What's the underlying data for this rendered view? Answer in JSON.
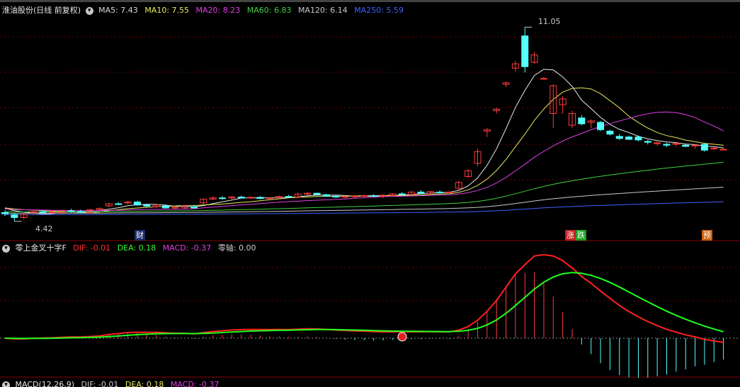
{
  "main_panel": {
    "stock_title": "淮油股份(日线 前复权)",
    "indicators": [
      {
        "text": "MA5: 7.43",
        "color": "#d8d8d8"
      },
      {
        "text": "MA10: 7.55",
        "color": "#e8e860"
      },
      {
        "text": "MA20: 8.23",
        "color": "#e040e0"
      },
      {
        "text": "MA60: 6.83",
        "color": "#40d040"
      },
      {
        "text": "MA120: 6.14",
        "color": "#c8c8c8"
      },
      {
        "text": "MA250: 5.59",
        "color": "#4060ff"
      }
    ],
    "high_label": "11.05",
    "low_label": "4.42",
    "event_badges": [
      {
        "text": "财",
        "bg": "#1a2a6a",
        "color": "#ffffff"
      },
      {
        "text": "涨",
        "bg": "#c02020",
        "color": "#ffffff"
      },
      {
        "text": "跌",
        "bg": "#20a020",
        "color": "#ffffff"
      },
      {
        "text": "预",
        "bg": "#c86010",
        "color": "#ffffff"
      }
    ]
  },
  "sub_panel": {
    "title": "零上金叉十字F",
    "values": [
      {
        "text": "DIF: -0.01",
        "color": "#ff3030"
      },
      {
        "text": "DEA: 0.18",
        "color": "#30ff30"
      },
      {
        "text": "MACD: -0.37",
        "color": "#e040e0"
      },
      {
        "text": "零轴: 0.00",
        "color": "#c8c8c8"
      }
    ]
  },
  "bottom_panel": {
    "title": "MACD(12,26,9)",
    "values": [
      {
        "text": "DIF: -0.01",
        "color": "#c8c8c8"
      },
      {
        "text": "DEA: 0.18",
        "color": "#e8e860"
      },
      {
        "text": "MACD: -0.37",
        "color": "#e040e0"
      }
    ]
  },
  "colors": {
    "up": "#ff3b3b",
    "down": "#54ffff",
    "grid": "#7a0000",
    "background": "#000000"
  },
  "chart_data": {
    "type": "candlestick",
    "candles": [
      {
        "o": 4.72,
        "h": 4.8,
        "l": 4.6,
        "c": 4.68
      },
      {
        "o": 4.65,
        "h": 4.7,
        "l": 4.42,
        "c": 4.55
      },
      {
        "o": 4.55,
        "h": 4.7,
        "l": 4.5,
        "c": 4.65
      },
      {
        "o": 4.72,
        "h": 4.8,
        "l": 4.65,
        "c": 4.75
      },
      {
        "o": 4.75,
        "h": 4.8,
        "l": 4.7,
        "c": 4.72
      },
      {
        "o": 4.72,
        "h": 4.78,
        "l": 4.68,
        "c": 4.74
      },
      {
        "o": 4.72,
        "h": 4.8,
        "l": 4.65,
        "c": 4.78
      },
      {
        "o": 4.78,
        "h": 4.85,
        "l": 4.72,
        "c": 4.76
      },
      {
        "o": 4.76,
        "h": 4.82,
        "l": 4.7,
        "c": 4.73
      },
      {
        "o": 4.72,
        "h": 4.85,
        "l": 4.7,
        "c": 4.82
      },
      {
        "o": 4.82,
        "h": 4.9,
        "l": 4.78,
        "c": 4.86
      },
      {
        "o": 4.95,
        "h": 5.05,
        "l": 4.9,
        "c": 5.02
      },
      {
        "o": 5.02,
        "h": 5.08,
        "l": 4.98,
        "c": 5.0
      },
      {
        "o": 5.05,
        "h": 5.12,
        "l": 5.0,
        "c": 5.08
      },
      {
        "o": 5.08,
        "h": 5.12,
        "l": 4.95,
        "c": 4.98
      },
      {
        "o": 4.98,
        "h": 5.02,
        "l": 4.9,
        "c": 4.94
      },
      {
        "o": 4.92,
        "h": 5.0,
        "l": 4.88,
        "c": 4.98
      },
      {
        "o": 4.95,
        "h": 5.0,
        "l": 4.85,
        "c": 4.88
      },
      {
        "o": 4.88,
        "h": 4.95,
        "l": 4.82,
        "c": 4.9
      },
      {
        "o": 4.88,
        "h": 4.98,
        "l": 4.85,
        "c": 4.95
      },
      {
        "o": 4.92,
        "h": 4.98,
        "l": 4.85,
        "c": 4.88
      },
      {
        "o": 5.05,
        "h": 5.2,
        "l": 5.0,
        "c": 5.18
      },
      {
        "o": 5.18,
        "h": 5.28,
        "l": 5.15,
        "c": 5.22
      },
      {
        "o": 5.22,
        "h": 5.28,
        "l": 5.16,
        "c": 5.2
      },
      {
        "o": 5.22,
        "h": 5.28,
        "l": 5.18,
        "c": 5.25
      },
      {
        "o": 5.25,
        "h": 5.3,
        "l": 5.2,
        "c": 5.22
      },
      {
        "o": 5.22,
        "h": 5.28,
        "l": 5.18,
        "c": 5.24
      },
      {
        "o": 5.24,
        "h": 5.28,
        "l": 5.18,
        "c": 5.2
      },
      {
        "o": 5.2,
        "h": 5.25,
        "l": 5.15,
        "c": 5.22
      },
      {
        "o": 5.22,
        "h": 5.3,
        "l": 5.18,
        "c": 5.27
      },
      {
        "o": 5.27,
        "h": 5.32,
        "l": 5.22,
        "c": 5.25
      },
      {
        "o": 5.25,
        "h": 5.4,
        "l": 5.22,
        "c": 5.35
      },
      {
        "o": 5.35,
        "h": 5.42,
        "l": 5.3,
        "c": 5.38
      },
      {
        "o": 5.38,
        "h": 5.4,
        "l": 5.3,
        "c": 5.33
      },
      {
        "o": 5.33,
        "h": 5.36,
        "l": 5.25,
        "c": 5.28
      },
      {
        "o": 5.28,
        "h": 5.32,
        "l": 5.22,
        "c": 5.25
      },
      {
        "o": 5.25,
        "h": 5.3,
        "l": 5.2,
        "c": 5.27
      },
      {
        "o": 5.27,
        "h": 5.32,
        "l": 5.22,
        "c": 5.28
      },
      {
        "o": 5.28,
        "h": 5.33,
        "l": 5.24,
        "c": 5.3
      },
      {
        "o": 5.3,
        "h": 5.35,
        "l": 5.25,
        "c": 5.28
      },
      {
        "o": 5.28,
        "h": 5.34,
        "l": 5.22,
        "c": 5.31
      },
      {
        "o": 5.31,
        "h": 5.38,
        "l": 5.26,
        "c": 5.36
      },
      {
        "o": 5.36,
        "h": 5.42,
        "l": 5.3,
        "c": 5.34
      },
      {
        "o": 5.34,
        "h": 5.45,
        "l": 5.3,
        "c": 5.42
      },
      {
        "o": 5.42,
        "h": 5.48,
        "l": 5.35,
        "c": 5.38
      },
      {
        "o": 5.38,
        "h": 5.45,
        "l": 5.33,
        "c": 5.44
      },
      {
        "o": 5.42,
        "h": 5.48,
        "l": 5.36,
        "c": 5.4
      },
      {
        "o": 5.4,
        "h": 5.45,
        "l": 5.35,
        "c": 5.42
      },
      {
        "o": 5.55,
        "h": 5.8,
        "l": 5.5,
        "c": 5.75
      },
      {
        "o": 5.95,
        "h": 6.2,
        "l": 5.9,
        "c": 6.15
      },
      {
        "o": 6.4,
        "h": 6.9,
        "l": 6.3,
        "c": 6.8
      },
      {
        "o": 7.5,
        "h": 7.6,
        "l": 7.3,
        "c": 7.55
      },
      {
        "o": 8.2,
        "h": 8.3,
        "l": 8.1,
        "c": 8.25
      },
      {
        "o": 9.1,
        "h": 9.2,
        "l": 9.0,
        "c": 9.15
      },
      {
        "o": 9.65,
        "h": 9.9,
        "l": 9.55,
        "c": 9.8
      },
      {
        "o": 10.75,
        "h": 11.05,
        "l": 9.5,
        "c": 9.7
      },
      {
        "o": 9.85,
        "h": 10.2,
        "l": 9.8,
        "c": 10.1
      },
      {
        "o": 9.3,
        "h": 9.35,
        "l": 9.25,
        "c": 9.3
      },
      {
        "o": 8.1,
        "h": 9.1,
        "l": 7.6,
        "c": 9.05
      },
      {
        "o": 8.4,
        "h": 8.7,
        "l": 8.1,
        "c": 8.6
      },
      {
        "o": 7.7,
        "h": 8.2,
        "l": 7.6,
        "c": 8.1
      },
      {
        "o": 7.95,
        "h": 8.05,
        "l": 7.7,
        "c": 7.75
      },
      {
        "o": 7.8,
        "h": 7.9,
        "l": 7.6,
        "c": 7.85
      },
      {
        "o": 7.8,
        "h": 7.85,
        "l": 7.5,
        "c": 7.55
      },
      {
        "o": 7.5,
        "h": 7.55,
        "l": 7.35,
        "c": 7.4
      },
      {
        "o": 7.32,
        "h": 7.4,
        "l": 7.2,
        "c": 7.25
      },
      {
        "o": 7.3,
        "h": 7.35,
        "l": 7.2,
        "c": 7.22
      },
      {
        "o": 7.3,
        "h": 7.35,
        "l": 7.15,
        "c": 7.2
      },
      {
        "o": 7.15,
        "h": 7.2,
        "l": 7.05,
        "c": 7.12
      },
      {
        "o": 7.1,
        "h": 7.15,
        "l": 7.0,
        "c": 7.1
      },
      {
        "o": 7.05,
        "h": 7.1,
        "l": 6.95,
        "c": 7.02
      },
      {
        "o": 7.05,
        "h": 7.1,
        "l": 6.98,
        "c": 7.08
      },
      {
        "o": 7.02,
        "h": 7.06,
        "l": 6.96,
        "c": 6.98
      },
      {
        "o": 7.0,
        "h": 7.04,
        "l": 6.9,
        "c": 7.02
      },
      {
        "o": 7.05,
        "h": 7.1,
        "l": 6.8,
        "c": 6.85
      },
      {
        "o": 6.9,
        "h": 6.95,
        "l": 6.85,
        "c": 6.92
      },
      {
        "o": 6.88,
        "h": 6.92,
        "l": 6.84,
        "c": 6.88
      }
    ],
    "y_range": [
      4.2,
      11.3
    ],
    "high": 11.05,
    "low": 4.42,
    "ma": {
      "MA5": {
        "color": "#e8e8e8",
        "last": 7.43
      },
      "MA10": {
        "color": "#e8e860",
        "last": 7.55
      },
      "MA20": {
        "color": "#e040e0",
        "last": 8.23
      },
      "MA60": {
        "color": "#40d040",
        "last": 6.83
      },
      "MA120": {
        "color": "#c8c8c8",
        "last": 6.14
      },
      "MA250": {
        "color": "#4060ff",
        "last": 5.59
      }
    }
  }
}
